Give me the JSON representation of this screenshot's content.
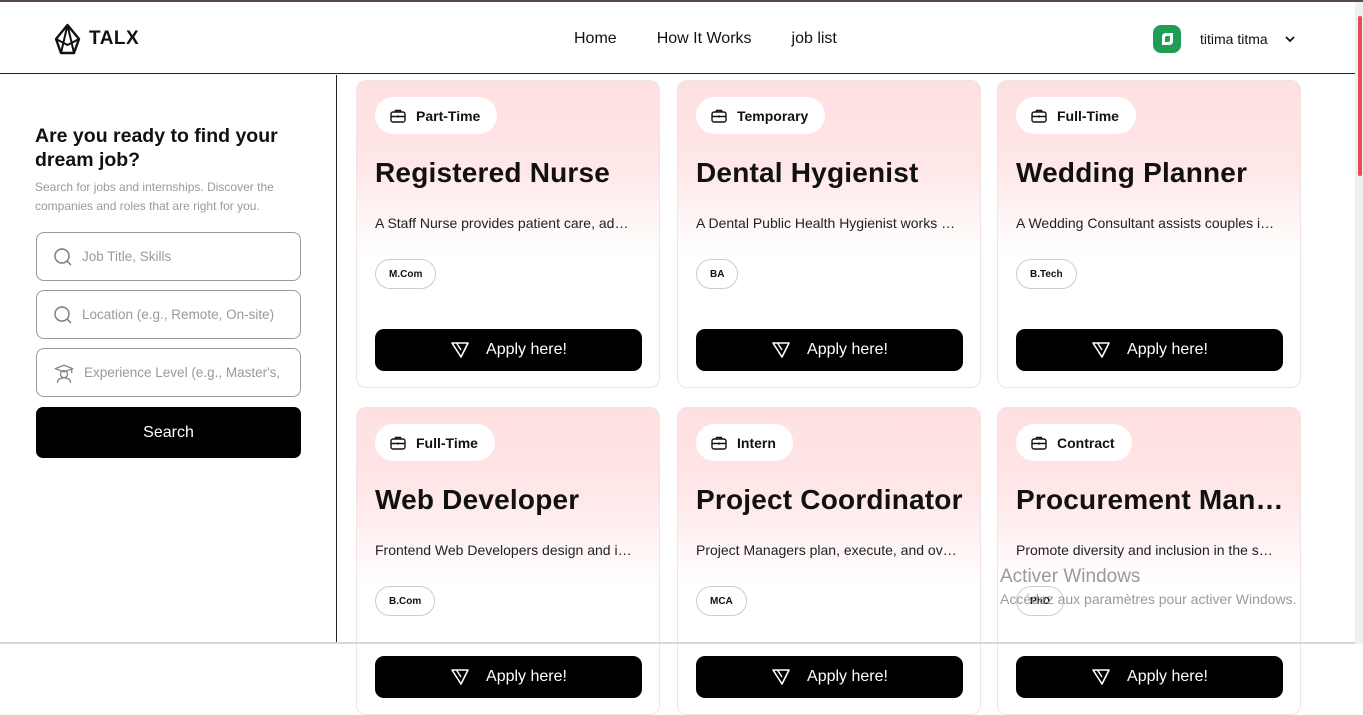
{
  "brand": {
    "name": "TALX"
  },
  "nav": {
    "items": [
      "Home",
      "How It Works",
      "job list"
    ]
  },
  "user": {
    "name": "titima titma",
    "avatar_color": "#1f9d55"
  },
  "sidebar": {
    "title": "Are you ready to find your dream job?",
    "subtitle": "Search for jobs and internships. Discover the companies and roles that are right for you.",
    "fields": [
      {
        "placeholder": "Job Title, Skills",
        "icon": "search-icon"
      },
      {
        "placeholder": "Location (e.g., Remote, On-site)",
        "icon": "search-icon"
      },
      {
        "placeholder": "Experience Level (e.g., Master's,",
        "icon": "graduate-icon"
      }
    ],
    "search_label": "Search"
  },
  "jobs": [
    {
      "type": "Part-Time",
      "title": "Registered Nurse",
      "description": "A Staff Nurse provides patient care, administers medications",
      "degree": "M.Com",
      "apply_label": "Apply here!"
    },
    {
      "type": "Temporary",
      "title": "Dental Hygienist",
      "description": "A Dental Public Health Hygienist works to improve",
      "degree": "BA",
      "apply_label": "Apply here!"
    },
    {
      "type": "Full-Time",
      "title": "Wedding Planner",
      "description": "A Wedding Consultant assists couples in planning",
      "degree": "B.Tech",
      "apply_label": "Apply here!"
    },
    {
      "type": "Full-Time",
      "title": "Web Developer",
      "description": "Frontend Web Developers design and implement",
      "degree": "B.Com",
      "apply_label": "Apply here!"
    },
    {
      "type": "Intern",
      "title": "Project Coordinator",
      "description": "Project Managers plan, execute, and oversee projects",
      "degree": "MCA",
      "apply_label": "Apply here!"
    },
    {
      "type": "Contract",
      "title": "Procurement Manager",
      "description": "Promote diversity and inclusion in the supply chain",
      "degree": "PhD",
      "apply_label": "Apply here!"
    }
  ],
  "watermark": {
    "line1": "Activer Windows",
    "line2": "Accédez aux paramètres pour activer Windows."
  }
}
